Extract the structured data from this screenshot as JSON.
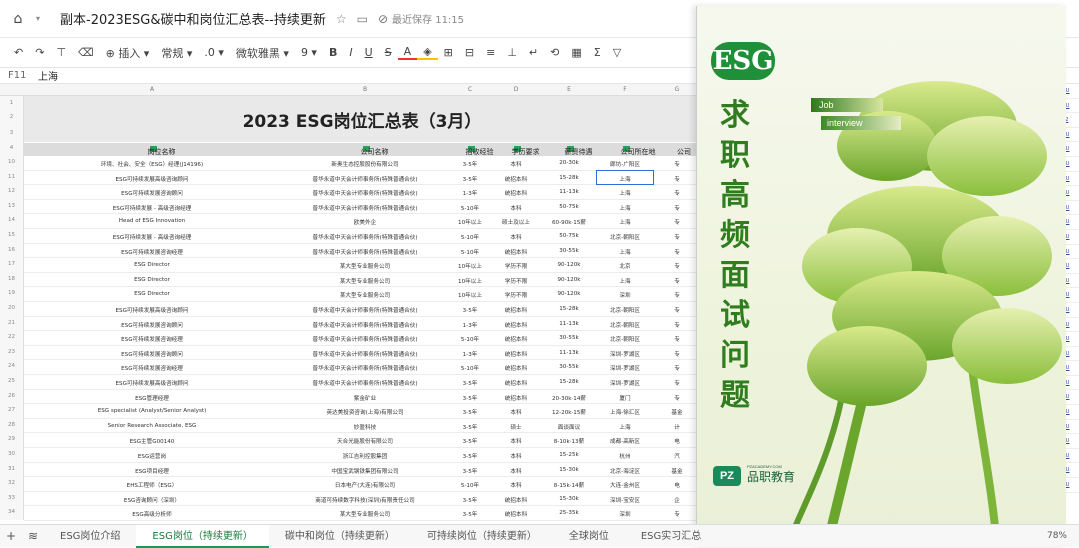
{
  "window": {
    "doc_title": "副本-2023ESG&碳中和岗位汇总表--持续更新",
    "saved_status": "最近保存 11:15"
  },
  "toolbar": {
    "insert_label": "插入",
    "format_label": "常规",
    "decimal_label": ".0",
    "font_label": "微软雅黑",
    "size_label": "9"
  },
  "formula_bar": {
    "cell_ref": "F11",
    "value": "上海"
  },
  "sheet": {
    "column_letters": [
      "A",
      "B",
      "C",
      "D",
      "E",
      "F",
      "G"
    ],
    "title": "2023 ESG岗位汇总表（3月）",
    "headers": [
      "岗位名称",
      "公司名称",
      "招收经验",
      "学历要求",
      "薪资待遇",
      "公司所在地",
      "公司"
    ],
    "row_numbers": [
      "1",
      "2",
      "3",
      "4",
      "10",
      "11",
      "12",
      "13",
      "14",
      "15",
      "16",
      "17",
      "18",
      "19",
      "20",
      "21",
      "22",
      "23",
      "24",
      "25",
      "26",
      "27",
      "28",
      "29",
      "30",
      "31",
      "32",
      "33",
      "34"
    ],
    "rows": [
      [
        "环境、社会、安全（ESG）经理(J14196)",
        "新奥生态控股股份有限公司",
        "3-5年",
        "本科",
        "20-30k",
        "廊坊-广阳区",
        "专"
      ],
      [
        "ESG可持续发展高级咨询顾问",
        "普华永道中天会计师事务所(特殊普通合伙)",
        "3-5年",
        "统招本科",
        "15-28k",
        "上海",
        "专"
      ],
      [
        "ESG可持续发展咨询顾问",
        "普华永道中天会计师事务所(特殊普通合伙)",
        "1-3年",
        "统招本科",
        "11-13k",
        "上海",
        "专"
      ],
      [
        "ESG可持续发展 - 高级咨询经理",
        "普华永道中天会计师事务所(特殊普通合伙)",
        "5-10年",
        "本科",
        "50-75k",
        "上海",
        "专"
      ],
      [
        "Head of ESG Innovation",
        "欧美外企",
        "10年以上",
        "硕士及以上",
        "60-90k·15薪",
        "上海",
        "专"
      ],
      [
        "ESG可持续发展 - 高级咨询经理",
        "普华永道中天会计师事务所(特殊普通合伙)",
        "5-10年",
        "本科",
        "50-75k",
        "北京-朝阳区",
        "专"
      ],
      [
        "ESG可持续发展咨询经理",
        "普华永道中天会计师事务所(特殊普通合伙)",
        "5-10年",
        "统招本科",
        "30-55k",
        "上海",
        "专"
      ],
      [
        "ESG Director",
        "某大型专业服务公司",
        "10年以上",
        "学历不限",
        "90-120k",
        "北京",
        "专"
      ],
      [
        "ESG Director",
        "某大型专业服务公司",
        "10年以上",
        "学历不限",
        "90-120k",
        "上海",
        "专"
      ],
      [
        "ESG Director",
        "某大型专业服务公司",
        "10年以上",
        "学历不限",
        "90-120k",
        "深圳",
        "专"
      ],
      [
        "ESG可持续发展高级咨询顾问",
        "普华永道中天会计师事务所(特殊普通合伙)",
        "3-5年",
        "统招本科",
        "15-28k",
        "北京-朝阳区",
        "专"
      ],
      [
        "ESG可持续发展咨询顾问",
        "普华永道中天会计师事务所(特殊普通合伙)",
        "1-3年",
        "统招本科",
        "11-13k",
        "北京-朝阳区",
        "专"
      ],
      [
        "ESG可持续发展咨询经理",
        "普华永道中天会计师事务所(特殊普通合伙)",
        "5-10年",
        "统招本科",
        "30-55k",
        "北京-朝阳区",
        "专"
      ],
      [
        "ESG可持续发展咨询顾问",
        "普华永道中天会计师事务所(特殊普通合伙)",
        "1-3年",
        "统招本科",
        "11-13k",
        "深圳-罗湖区",
        "专"
      ],
      [
        "ESG可持续发展咨询经理",
        "普华永道中天会计师事务所(特殊普通合伙)",
        "5-10年",
        "统招本科",
        "30-55k",
        "深圳-罗湖区",
        "专"
      ],
      [
        "ESG可持续发展高级咨询顾问",
        "普华永道中天会计师事务所(特殊普通合伙)",
        "3-5年",
        "统招本科",
        "15-28k",
        "深圳-罗湖区",
        "专"
      ],
      [
        "ESG管理经理",
        "紫金矿业",
        "3-5年",
        "统招本科",
        "20-30k·14薪",
        "厦门",
        "专"
      ],
      [
        "ESG specialist (Analyst/Senior Analyst)",
        "英达美投资咨询(上海)有限公司",
        "3-5年",
        "本科",
        "12-20k·15薪",
        "上海-徐汇区",
        "基金"
      ],
      [
        "Senior Research Associate, ESG",
        "妙盈科技",
        "3-5年",
        "硕士",
        "面谈面议",
        "上海",
        "计"
      ],
      [
        "ESG主管G00140",
        "天合光能股份有限公司",
        "3-5年",
        "本科",
        "8-10k·13薪",
        "成都-高新区",
        "电"
      ],
      [
        "ESG运营岗",
        "浙江吉利控股集团",
        "3-5年",
        "本科",
        "15-25k",
        "杭州",
        "汽"
      ],
      [
        "ESG项目经理",
        "中国宝武钢铁集团有限公司",
        "3-5年",
        "本科",
        "15-30k",
        "北京-海淀区",
        "基金"
      ],
      [
        "EHS工程师（ESG）",
        "日本电产(大连)有限公司",
        "5-10年",
        "本科",
        "8-15k·14薪",
        "大连-金州区",
        "电"
      ],
      [
        "ESG咨询顾问（深圳）",
        "商道可持续数字科技(深圳)有限责任公司",
        "3-5年",
        "统招本科",
        "15-30k",
        "深圳-宝安区",
        "企"
      ],
      [
        "ESG高级分析师",
        "某大型专业服务公司",
        "3-5年",
        "统招本科",
        "25-35k",
        "深圳",
        "专"
      ]
    ],
    "right_strip": [
      "MRU",
      "MRU",
      "HR2",
      "MRU",
      "MRU",
      "MRU",
      "MRU",
      "MRU",
      "MRU",
      "MRU",
      "MRU",
      "MRU",
      "MRU",
      "MRU",
      "MRU",
      "MRU",
      "MRU",
      "MRU",
      "MRU",
      "MRU",
      "MRU",
      "MRU",
      "MRU",
      "MRU",
      "MRU",
      "MRU",
      "MRU",
      "MRU"
    ]
  },
  "tabs": {
    "items": [
      "ESG岗位介绍",
      "ESG岗位（持续更新）",
      "碳中和岗位（持续更新）",
      "可持续岗位（持续更新）",
      "全球岗位",
      "ESG实习汇总"
    ],
    "active_index": 1,
    "zoom": "78%"
  },
  "poster": {
    "badge": "ESG",
    "vertical_title": [
      "求",
      "职",
      "高",
      "频",
      "面",
      "试",
      "问",
      "题"
    ],
    "job_label": "Job",
    "interview_label": "interview",
    "brand_mark": "PZ",
    "brand_name": "品职教育",
    "brand_url": "PZACADEMY.COM",
    "colors": {
      "badge": "#1f8f3a",
      "title": "#2f7d1e",
      "tree_light": "#c8df6a",
      "tree_dark": "#6aa52c"
    }
  }
}
